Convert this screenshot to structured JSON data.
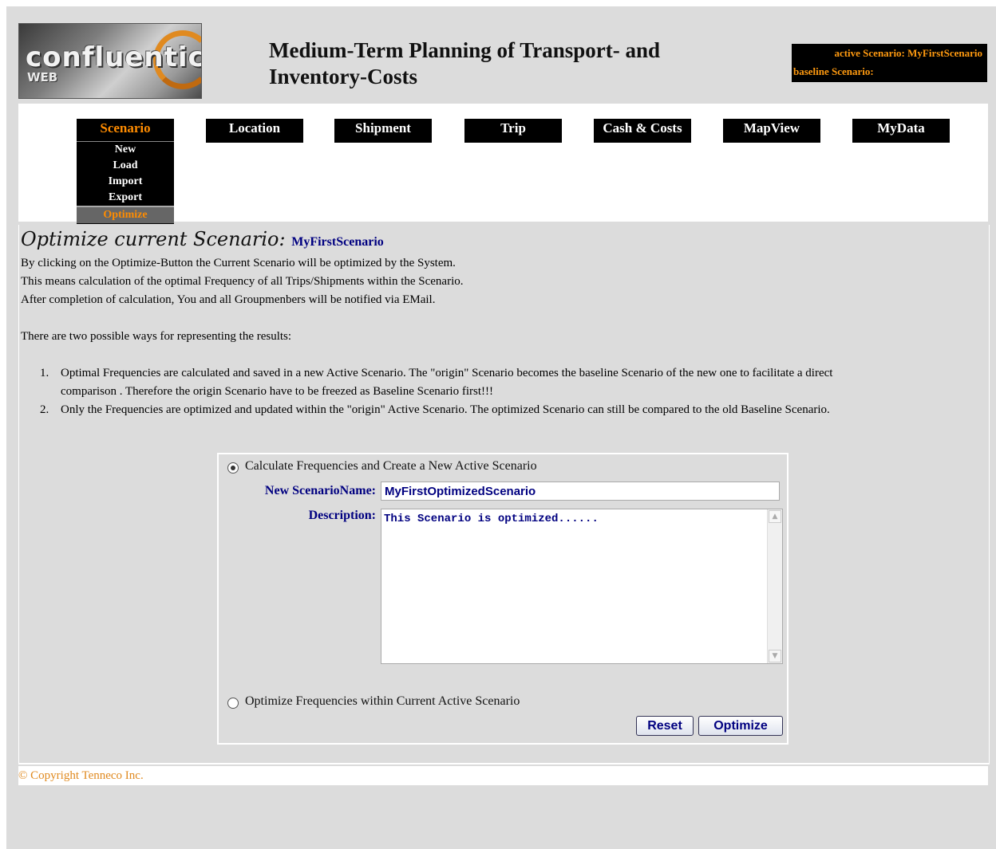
{
  "header": {
    "logo_main": "confluentic",
    "logo_sub": "WEB",
    "title_line1": "Medium-Term Planning of Transport- and",
    "title_line2": "Inventory-Costs",
    "active_scenario": "active Scenario: MyFirstScenario",
    "baseline_scenario": "baseline Scenario:"
  },
  "nav": {
    "items": [
      "Scenario",
      "Location",
      "Shipment",
      "Trip",
      "Cash & Costs",
      "MapView",
      "MyData"
    ],
    "submenu": [
      "New",
      "Load",
      "Import",
      "Export",
      "Optimize"
    ]
  },
  "content": {
    "heading": "Optimize current Scenario:",
    "scenario_name": "MyFirstScenario",
    "para1": "By clicking on the Optimize-Button the Current Scenario will be optimized by the System.",
    "para2": "This means calculation of the optimal Frequency of all Trips/Shipments within the Scenario.",
    "para3": "After completion of calculation, You and all Groupmenbers will be notified via EMail.",
    "para4": "There are two possible ways for representing the results:",
    "ways": [
      {
        "num": "1.",
        "line1": "Optimal Frequencies are calculated and saved in a new Active Scenario. The \"origin\" Scenario becomes the baseline Scenario of the new one to facilitate a direct",
        "line2": "comparison . Therefore the origin Scenario have to be freezed as Baseline Scenario first!!!"
      },
      {
        "num": "2.",
        "line1": "Only the Frequencies are optimized and updated within the \"origin\" Active Scenario. The optimized Scenario can still be compared to the old Baseline Scenario.",
        "line2": ""
      }
    ]
  },
  "form": {
    "option1_label": "Calculate Frequencies and Create a New Active Scenario",
    "name_label": "New ScenarioName:",
    "name_value": "MyFirstOptimizedScenario",
    "desc_label": "Description:",
    "desc_value": "This Scenario is optimized......",
    "option2_label": "Optimize Frequencies within Current Active Scenario",
    "reset_label": "Reset",
    "optimize_label": "Optimize"
  },
  "footer": {
    "copyright": "© Copyright Tenneco Inc."
  }
}
